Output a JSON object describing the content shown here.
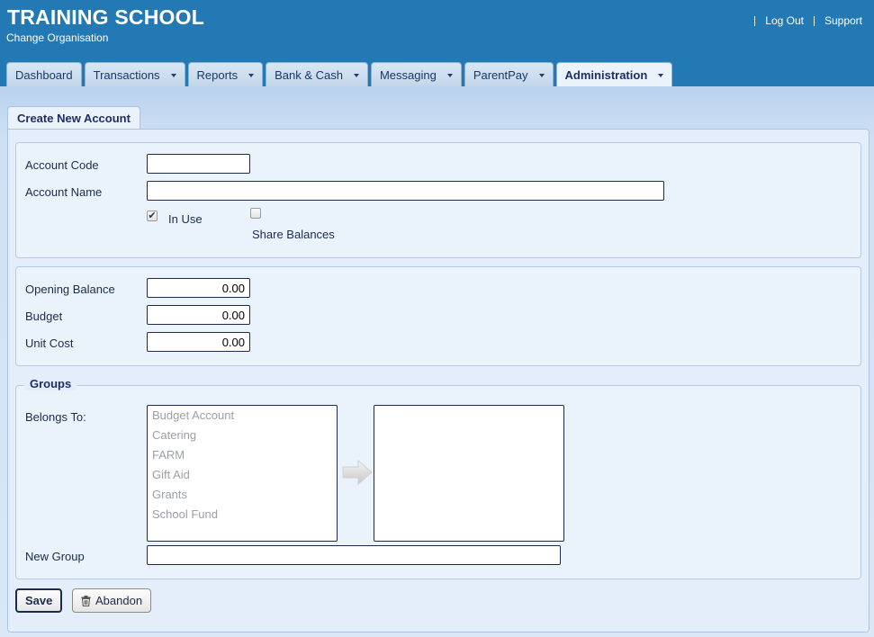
{
  "header": {
    "title": "TRAINING SCHOOL",
    "subtitle": "Change Organisation",
    "links": {
      "logout": "Log Out",
      "support": "Support"
    }
  },
  "nav": {
    "tabs": [
      {
        "label": "Dashboard",
        "dropdown": false,
        "active": false
      },
      {
        "label": "Transactions",
        "dropdown": true,
        "active": false
      },
      {
        "label": "Reports",
        "dropdown": true,
        "active": false
      },
      {
        "label": "Bank & Cash",
        "dropdown": true,
        "active": false
      },
      {
        "label": "Messaging",
        "dropdown": true,
        "active": false
      },
      {
        "label": "ParentPay",
        "dropdown": true,
        "active": false
      },
      {
        "label": "Administration",
        "dropdown": true,
        "active": true
      }
    ]
  },
  "page": {
    "tab_label": "Create New Account"
  },
  "account": {
    "code_label": "Account Code",
    "code_value": "",
    "name_label": "Account Name",
    "name_value": "",
    "in_use_label": "In Use",
    "in_use_checked": true,
    "share_label": "Share Balances",
    "share_checked": false
  },
  "balances": {
    "opening_label": "Opening Balance",
    "opening_value": "0.00",
    "budget_label": "Budget",
    "budget_value": "0.00",
    "unit_cost_label": "Unit Cost",
    "unit_cost_value": "0.00"
  },
  "groups": {
    "legend": "Groups",
    "belongs_label": "Belongs To:",
    "available": [
      "Budget Account",
      "Catering",
      "FARM",
      "Gift Aid",
      "Grants",
      "School Fund"
    ],
    "selected": [],
    "new_group_label": "New Group",
    "new_group_value": ""
  },
  "actions": {
    "save": "Save",
    "abandon": "Abandon"
  },
  "colors": {
    "header_bg": "#2379b4",
    "panel_bg": "#e4eefa",
    "accent": "#1f2f63"
  },
  "icons": {
    "move": "arrow-right-icon",
    "abandon": "trash-icon"
  }
}
